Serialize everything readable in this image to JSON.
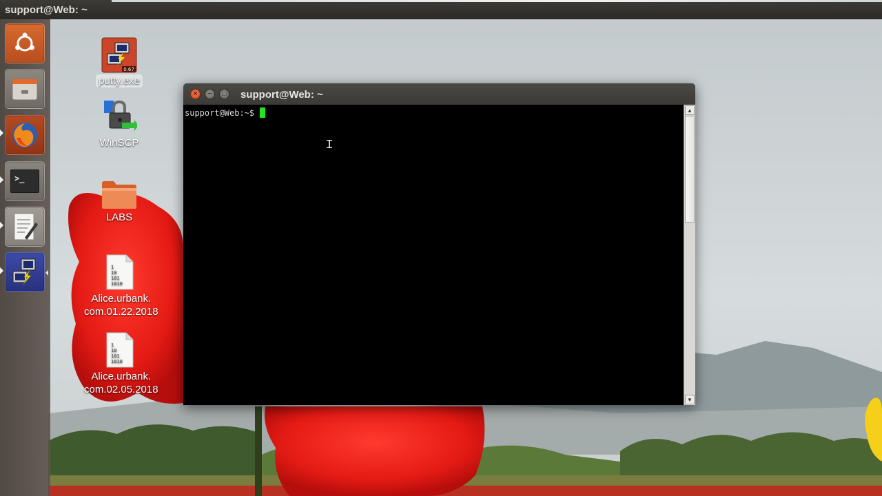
{
  "panel": {
    "title": "support@Web: ~"
  },
  "launcher": {
    "items": [
      {
        "name": "dash",
        "icon": "ubuntu-logo-icon"
      },
      {
        "name": "files",
        "icon": "file-manager-icon"
      },
      {
        "name": "firefox",
        "icon": "firefox-icon"
      },
      {
        "name": "terminal",
        "icon": "terminal-icon",
        "glyph": ">_"
      },
      {
        "name": "text-editor",
        "icon": "text-editor-icon"
      },
      {
        "name": "putty",
        "icon": "putty-icon"
      }
    ]
  },
  "desktop": {
    "icons": [
      {
        "label": "putty.exe",
        "icon": "putty-exe-icon",
        "badge": "0.67",
        "selected": true
      },
      {
        "label": "WinSCP",
        "icon": "winscp-icon"
      },
      {
        "label": "LABS",
        "icon": "folder-icon"
      },
      {
        "label_line1": "Alice.urbank.",
        "label_line2": "com.01.22.2018",
        "icon": "binary-file-icon",
        "file_glyph": "1 10 101 1010"
      },
      {
        "label_line1": "Alice.urbank.",
        "label_line2": "com.02.05.2018",
        "icon": "binary-file-icon",
        "file_glyph": "1 10 101 1010"
      }
    ]
  },
  "terminal": {
    "title": "support@Web: ~",
    "prompt": "support@Web:~$ ",
    "close_glyph": "×",
    "min_glyph": "−",
    "max_glyph": "□",
    "scroll_up_glyph": "▲",
    "scroll_down_glyph": "▼",
    "cursor_color": "#22e81a"
  },
  "colors": {
    "panel_bg": "#3c3b37",
    "launcher_bg": "#4e4640",
    "terminal_bg": "#000000",
    "close_button": "#e0562f"
  }
}
